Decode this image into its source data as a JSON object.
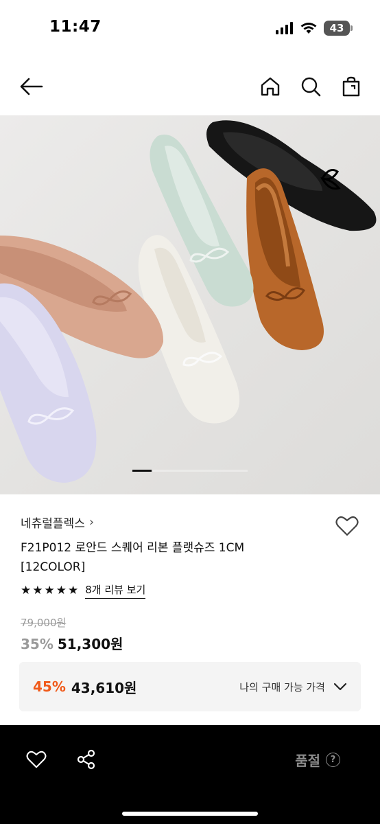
{
  "status": {
    "time": "11:47",
    "battery": "43"
  },
  "nav": {
    "back_icon": "arrow-left-icon",
    "home_icon": "home-icon",
    "search_icon": "search-icon",
    "bag_icon": "shopping-bag-icon"
  },
  "hero": {
    "pager_current": 1
  },
  "product": {
    "brand": "네츄럴플렉스",
    "brand_chevron": "›",
    "title_line1": "F21P012 로안드 스퀘어 리본 플랫슈즈 1CM",
    "title_line2": "[12COLOR]",
    "rating_stars": 5,
    "review_link": "8개 리뷰 보기",
    "original_price": "79,000원",
    "sale_rate": "35%",
    "sale_price": "51,300원"
  },
  "benefit": {
    "rate": "45%",
    "price": "43,610원",
    "label": "나의 구매 가능 가격"
  },
  "bottom_bar": {
    "soldout_label": "품절",
    "help_glyph": "?"
  },
  "colors": {
    "accent_orange": "#f05a1a",
    "bottom_bar_bg": "#000000",
    "muted_gray": "#9a9a9a"
  }
}
